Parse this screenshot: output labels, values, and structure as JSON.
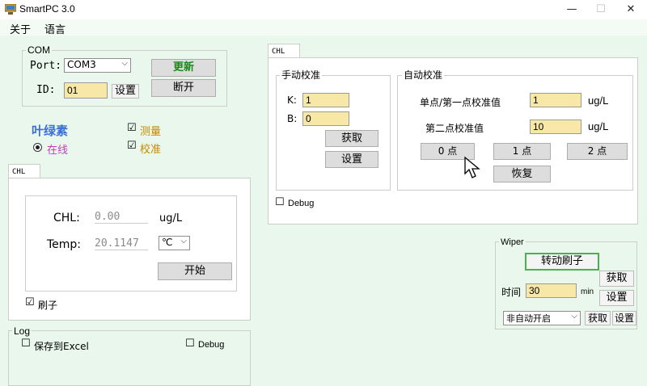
{
  "window": {
    "title": "SmartPC 3.0",
    "minimize": "—",
    "maximize": "☐",
    "close": "✕"
  },
  "menu": {
    "about": "关于",
    "language": "语言"
  },
  "com": {
    "group_label": "COM",
    "port_label": "Port:",
    "port_value": "COM3",
    "update_button": "更新",
    "id_label": "ID:",
    "id_value": "01",
    "set_button": "设置",
    "disconnect_button": "断开"
  },
  "status": {
    "device_name": "叶绿素",
    "online_label": "在线",
    "measure_label": "测量",
    "calibrate_label": "校准"
  },
  "chl_panel": {
    "tab_label": "CHL",
    "chl_label": "CHL:",
    "chl_value": "0.00",
    "chl_unit": "ug/L",
    "temp_label": "Temp:",
    "temp_value": "20.1147",
    "temp_unit": "℃",
    "start_button": "开始",
    "brush_label": "刷子"
  },
  "log": {
    "group_label": "Log",
    "save_excel_label": "保存到Excel",
    "debug_label": "Debug"
  },
  "calibration": {
    "tab_label": "CHL",
    "manual": {
      "group_label": "手动校准",
      "k_label": "K:",
      "k_value": "1",
      "b_label": "B:",
      "b_value": "0",
      "get_button": "获取",
      "set_button": "设置"
    },
    "auto": {
      "group_label": "自动校准",
      "point1_label": "单点/第一点校准值",
      "point1_value": "1",
      "point1_unit": "ug/L",
      "point2_label": "第二点校准值",
      "point2_value": "10",
      "point2_unit": "ug/L",
      "zero_button": "0 点",
      "one_button": "1 点",
      "two_button": "2 点",
      "restore_button": "恢复"
    },
    "debug_label": "Debug"
  },
  "wiper": {
    "group_label": "Wiper",
    "rotate_button": "转动刷子",
    "get_button": "获取",
    "time_label": "时间",
    "time_value": "30",
    "time_unit": "min",
    "set_button": "设置",
    "mode_value": "非自动开启",
    "get_button2": "获取",
    "set_button2": "设置"
  },
  "colors": {
    "background": "#e9f7ec",
    "field": "#f8e8a8",
    "device_name": "#3a6fd8",
    "online": "#c43cc4",
    "measure": "#c88a00",
    "rotate_border": "#4caf50"
  }
}
